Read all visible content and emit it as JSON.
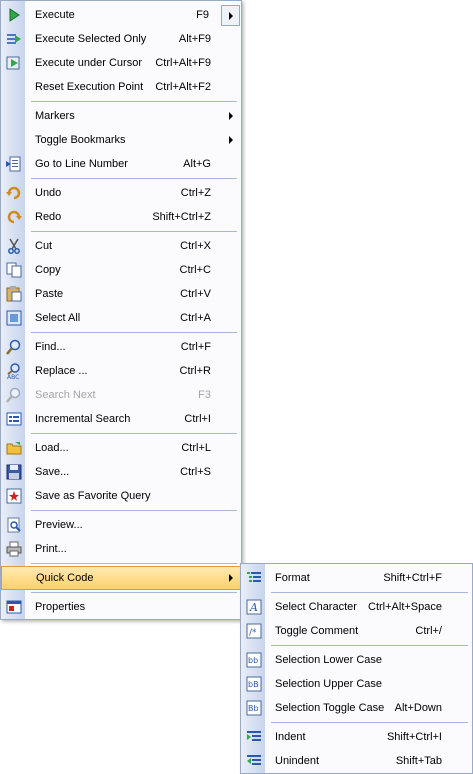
{
  "main_menu": {
    "items": [
      {
        "label": "Execute",
        "shortcut": "F9",
        "icon": "execute-icon"
      },
      {
        "label": "Execute Selected Only",
        "shortcut": "Alt+F9",
        "icon": "execute-selected-icon"
      },
      {
        "label": "Execute under Cursor",
        "shortcut": "Ctrl+Alt+F9",
        "icon": "execute-cursor-icon"
      },
      {
        "label": "Reset Execution Point",
        "shortcut": "Ctrl+Alt+F2"
      },
      {
        "label": "Markers",
        "shortcut": ""
      },
      {
        "label": "Toggle Bookmarks",
        "shortcut": ""
      },
      {
        "label": "Go to Line Number",
        "shortcut": "Alt+G",
        "icon": "goto-line-icon"
      },
      {
        "label": "Undo",
        "shortcut": "Ctrl+Z",
        "icon": "undo-icon"
      },
      {
        "label": "Redo",
        "shortcut": "Shift+Ctrl+Z",
        "icon": "redo-icon"
      },
      {
        "label": "Cut",
        "shortcut": "Ctrl+X",
        "icon": "cut-icon"
      },
      {
        "label": "Copy",
        "shortcut": "Ctrl+C",
        "icon": "copy-icon"
      },
      {
        "label": "Paste",
        "shortcut": "Ctrl+V",
        "icon": "paste-icon"
      },
      {
        "label": "Select All",
        "shortcut": "Ctrl+A",
        "icon": "select-all-icon"
      },
      {
        "label": "Find...",
        "shortcut": "Ctrl+F",
        "icon": "find-icon"
      },
      {
        "label": "Replace ...",
        "shortcut": "Ctrl+R",
        "icon": "replace-icon"
      },
      {
        "label": "Search Next",
        "shortcut": "F3",
        "icon": "search-next-icon",
        "disabled": true
      },
      {
        "label": "Incremental Search",
        "shortcut": "Ctrl+I",
        "icon": "incremental-search-icon"
      },
      {
        "label": "Load...",
        "shortcut": "Ctrl+L",
        "icon": "load-icon"
      },
      {
        "label": "Save...",
        "shortcut": "Ctrl+S",
        "icon": "save-icon"
      },
      {
        "label": "Save as Favorite Query",
        "shortcut": "",
        "icon": "favorite-icon"
      },
      {
        "label": "Preview...",
        "shortcut": "",
        "icon": "preview-icon"
      },
      {
        "label": "Print...",
        "shortcut": "",
        "icon": "print-icon"
      },
      {
        "label": "Quick Code",
        "shortcut": ""
      },
      {
        "label": "Properties",
        "shortcut": "",
        "icon": "properties-icon"
      }
    ]
  },
  "quick_code_menu": {
    "items": [
      {
        "label": "Format",
        "shortcut": "Shift+Ctrl+F",
        "icon": "format-icon"
      },
      {
        "label": "Select Character",
        "shortcut": "Ctrl+Alt+Space",
        "icon": "select-character-icon"
      },
      {
        "label": "Toggle Comment",
        "shortcut": "Ctrl+/",
        "icon": "toggle-comment-icon"
      },
      {
        "label": "Selection Lower Case",
        "shortcut": "",
        "icon": "lower-case-icon"
      },
      {
        "label": "Selection Upper Case",
        "shortcut": "",
        "icon": "upper-case-icon"
      },
      {
        "label": "Selection Toggle Case",
        "shortcut": "Alt+Down",
        "icon": "toggle-case-icon"
      },
      {
        "label": "Indent",
        "shortcut": "Shift+Ctrl+I",
        "icon": "indent-icon"
      },
      {
        "label": "Unindent",
        "shortcut": "Shift+Tab",
        "icon": "unindent-icon"
      }
    ]
  },
  "colors": {
    "gutter_light": "#e9eef8",
    "gutter_dark": "#c7d4ec",
    "highlight_top": "#ffeab3",
    "highlight_bottom": "#ffd06a",
    "border": "#9aaac4",
    "disabled_text": "#a4a4a4"
  }
}
